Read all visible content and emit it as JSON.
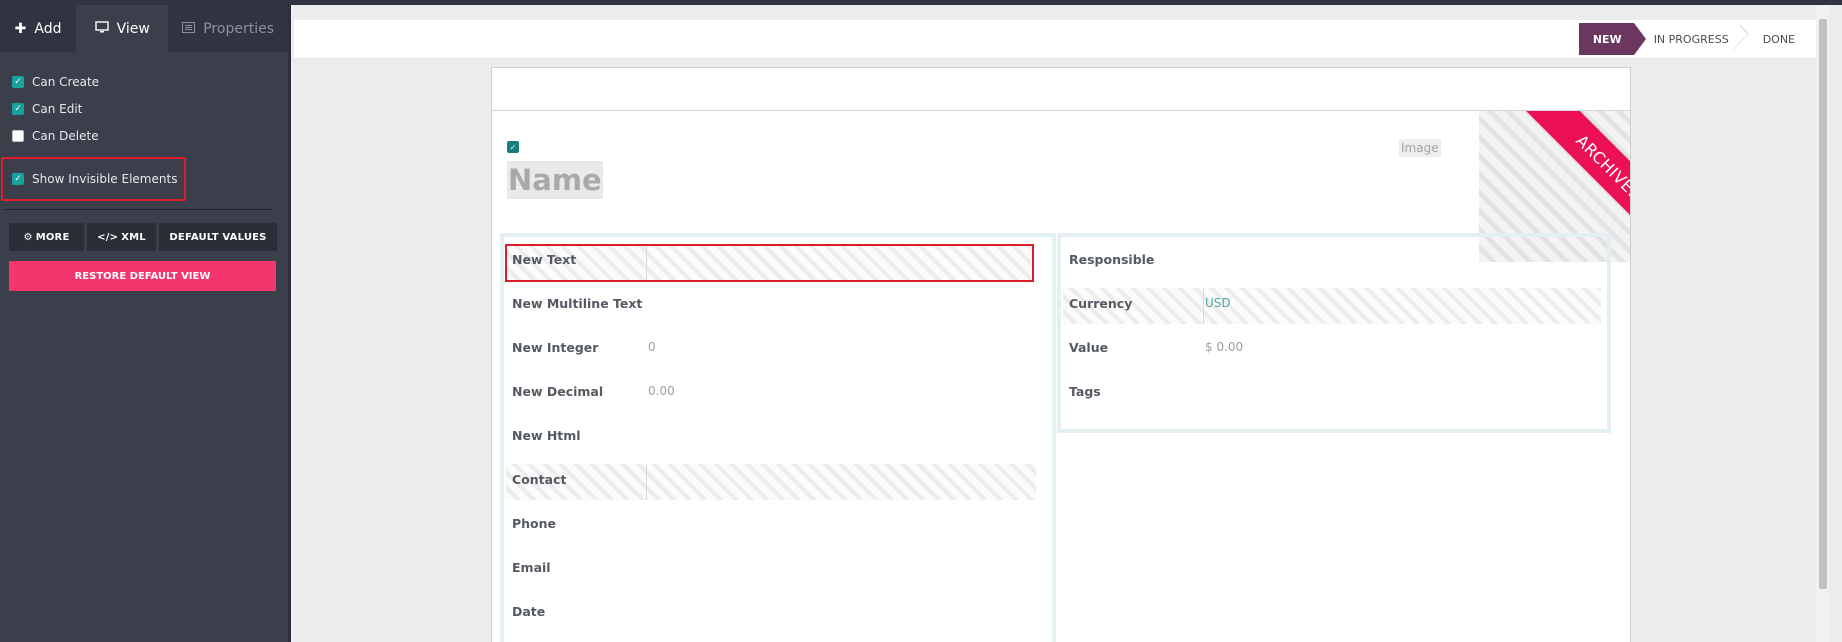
{
  "sidebar": {
    "tabs": [
      {
        "label": "Add",
        "icon": "plus-icon"
      },
      {
        "label": "View",
        "icon": "monitor-icon"
      },
      {
        "label": "Properties",
        "icon": "list-icon"
      }
    ],
    "checkboxes": [
      {
        "label": "Can Create",
        "checked": true
      },
      {
        "label": "Can Edit",
        "checked": true
      },
      {
        "label": "Can Delete",
        "checked": false
      },
      {
        "label": "Show Invisible Elements",
        "checked": true
      }
    ],
    "buttons": {
      "more": "MORE",
      "xml": "XML",
      "default_values": "DEFAULT VALUES",
      "restore": "RESTORE DEFAULT VIEW"
    }
  },
  "statusbar": {
    "stages": [
      "NEW",
      "IN PROGRESS",
      "DONE"
    ],
    "active_stage": "NEW"
  },
  "form": {
    "ribbon": "ARCHIVED",
    "name_placeholder": "Name",
    "image_label": "Image",
    "left_fields": [
      {
        "label": "New Text",
        "value": ""
      },
      {
        "label": "New Multiline Text",
        "value": ""
      },
      {
        "label": "New Integer",
        "value": "0"
      },
      {
        "label": "New Decimal",
        "value": "0.00"
      },
      {
        "label": "New Html",
        "value": ""
      },
      {
        "label": "Contact",
        "value": ""
      },
      {
        "label": "Phone",
        "value": ""
      },
      {
        "label": "Email",
        "value": ""
      },
      {
        "label": "Date",
        "value": ""
      }
    ],
    "right_fields": [
      {
        "label": "Responsible",
        "value": ""
      },
      {
        "label": "Currency",
        "value": "USD"
      },
      {
        "label": "Value",
        "value": "$ 0.00"
      },
      {
        "label": "Tags",
        "value": ""
      }
    ]
  },
  "colors": {
    "sidebar_bg": "#3a3f4b",
    "accent_pink": "#f3366e",
    "stage_active": "#6b3761",
    "ribbon": "#eb1154",
    "check_teal": "#17a2a0",
    "highlight_red": "#dc1d2c"
  }
}
